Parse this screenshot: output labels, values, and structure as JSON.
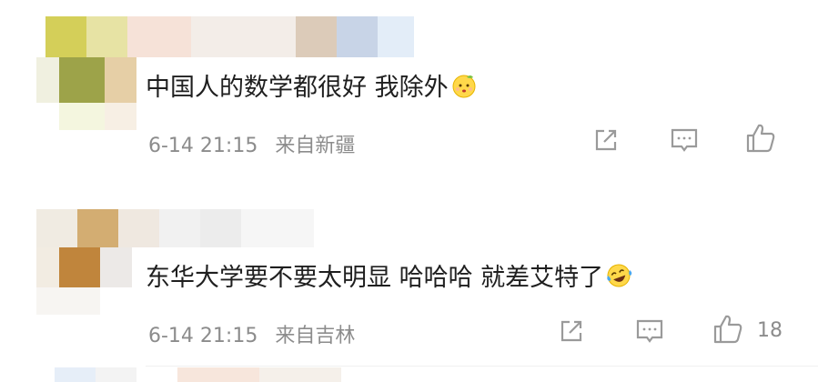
{
  "comments": [
    {
      "text": "中国人的数学都很好 我除外",
      "emoji": "sweat-smile-emoji",
      "time": "6-14 21:15",
      "location": "来自新疆",
      "likes": ""
    },
    {
      "text": "东华大学要不要太明显 哈哈哈 就差艾特了",
      "emoji": "laughing-tears-emoji",
      "time": "6-14 21:15",
      "location": "来自吉林",
      "likes": "18"
    }
  ],
  "icons": {
    "share": "share-icon",
    "reply": "comment-icon",
    "like": "thumbs-up-icon"
  },
  "colors": {
    "text": "#1f1f1f",
    "meta": "#8c8c8c",
    "icon": "#9a9a9a"
  }
}
